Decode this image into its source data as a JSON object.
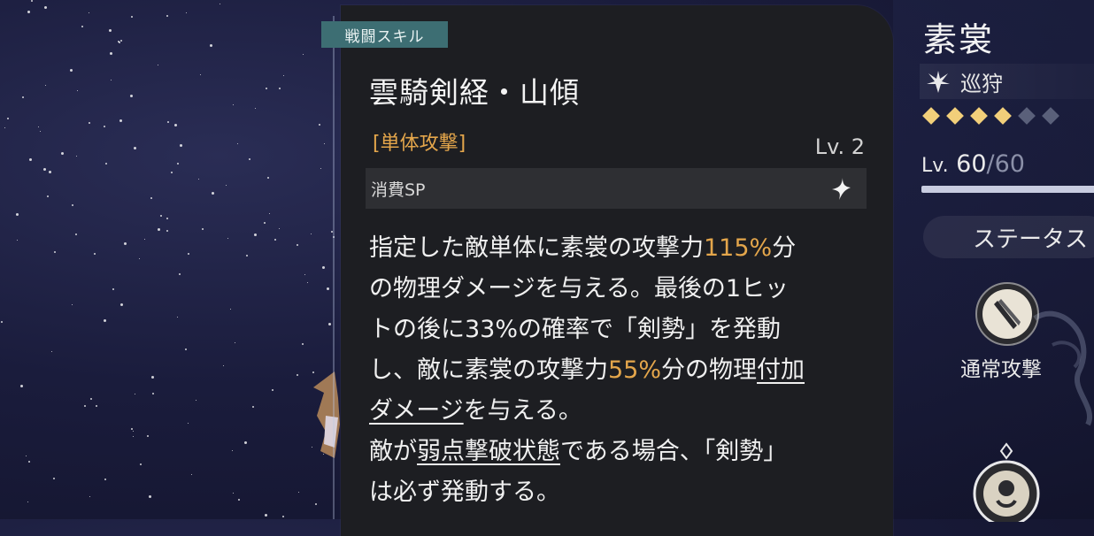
{
  "tag": {
    "label": "戦闘スキル"
  },
  "skill": {
    "name": "雲騎剣経・山傾",
    "type": "[単体攻撃]",
    "level": "Lv. 2",
    "sp_label": "消費SP"
  },
  "description": {
    "l1a": "指定した敵単体に素裳の攻撃力",
    "l1num": "115%",
    "l1b": "分",
    "l2": "の物理ダメージを与える。最後の1ヒッ",
    "l3": "トの後に33%の確率で「剣勢」を発動",
    "l4a": "し、敵に素裳の攻撃力",
    "l4num": "55%",
    "l4b": "分の物理",
    "l4link": "付加",
    "l5link": "ダメージ",
    "l5b": "を与える。",
    "l6a": "敵が",
    "l6link": "弱点撃破状態",
    "l6b": "である場合、「剣勢」",
    "l7": "は必ず発動する。"
  },
  "character": {
    "name": "素裳",
    "path": "巡狩",
    "stars_filled": 4,
    "stars_total": 6,
    "level_prefix": "Lv.",
    "level_current": "60",
    "level_max": "/60",
    "status_button": "ステータス",
    "basic_attack": "通常攻撃"
  },
  "colors": {
    "accent_orange": "#e4a64b",
    "tag_teal": "#3d6e73",
    "panel_bg": "#1d1e22",
    "star_gold": "#f2cf7a"
  },
  "icons": {
    "sp": "sparkle-icon",
    "path": "hunt-path-icon",
    "basic_attack": "sword-icon"
  }
}
